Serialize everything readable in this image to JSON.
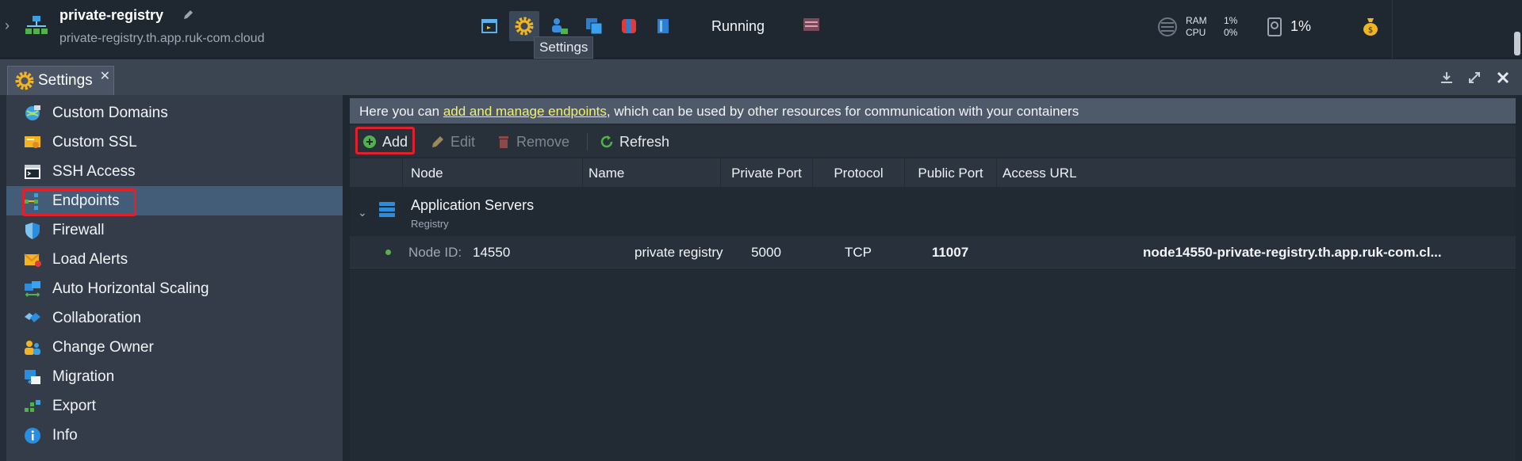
{
  "env": {
    "name": "private-registry",
    "domain": "private-registry.th.app.ruk-com.cloud",
    "status": "Running"
  },
  "tooltip": "Settings",
  "metrics": {
    "ram_label": "RAM",
    "cpu_label": "CPU",
    "ram_value": "1%",
    "cpu_value": "0%",
    "disk_value": "1%"
  },
  "tab": {
    "label": "Settings"
  },
  "sidebar": {
    "items": [
      {
        "label": "Custom Domains",
        "icon": "globe-icon"
      },
      {
        "label": "Custom SSL",
        "icon": "certificate-icon"
      },
      {
        "label": "SSH Access",
        "icon": "terminal-icon"
      },
      {
        "label": "Endpoints",
        "icon": "endpoints-icon",
        "active": true
      },
      {
        "label": "Firewall",
        "icon": "shield-icon"
      },
      {
        "label": "Load Alerts",
        "icon": "mail-alert-icon"
      },
      {
        "label": "Auto Horizontal Scaling",
        "icon": "scaling-icon"
      },
      {
        "label": "Collaboration",
        "icon": "handshake-icon"
      },
      {
        "label": "Change Owner",
        "icon": "users-icon"
      },
      {
        "label": "Migration",
        "icon": "migration-icon"
      },
      {
        "label": "Export",
        "icon": "export-icon"
      },
      {
        "label": "Info",
        "icon": "info-icon"
      }
    ]
  },
  "banner": {
    "prefix": "Here you can ",
    "link": "add and manage endpoints",
    "suffix": ", which can be used by other resources for communication with your containers"
  },
  "toolbar": {
    "add": "Add",
    "edit": "Edit",
    "remove": "Remove",
    "refresh": "Refresh"
  },
  "grid": {
    "columns": [
      "Node",
      "Name",
      "Private Port",
      "Protocol",
      "Public Port",
      "Access URL"
    ],
    "group": {
      "title": "Application Servers",
      "subtitle": "Registry"
    },
    "rows": [
      {
        "node_prefix": "Node ID:",
        "node_id": "14550",
        "name": "private registry",
        "private_port": "5000",
        "protocol": "TCP",
        "public_port": "11007",
        "access_url": "node14550-private-registry.th.app.ruk-com.cl..."
      }
    ]
  },
  "colors": {
    "accent_highlight": "#e0202a",
    "active_item": "#435c78",
    "link": "#f5f069",
    "status_dot": "#5eae4a"
  }
}
